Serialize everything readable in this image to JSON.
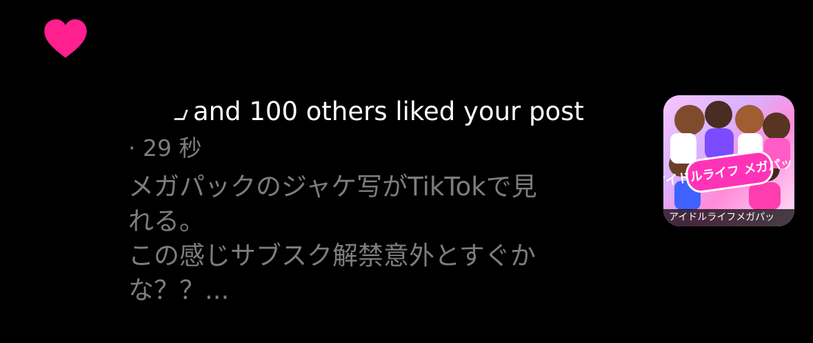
{
  "notification": {
    "headline_text": "and 100 others liked your post",
    "timestamp": "· 29 秒",
    "post_excerpt": "メガパックのジャケ写がTikTokで見\nれる。\nこの感じサブスク解禁意外とすぐか\nな？？...",
    "heart_color": "#ff1f8e"
  },
  "thumbnail": {
    "caption": "アイドルライフメガパッ",
    "logo_text": "アイドルライフ メガパック"
  },
  "icons": {
    "heart": "heart-icon"
  }
}
